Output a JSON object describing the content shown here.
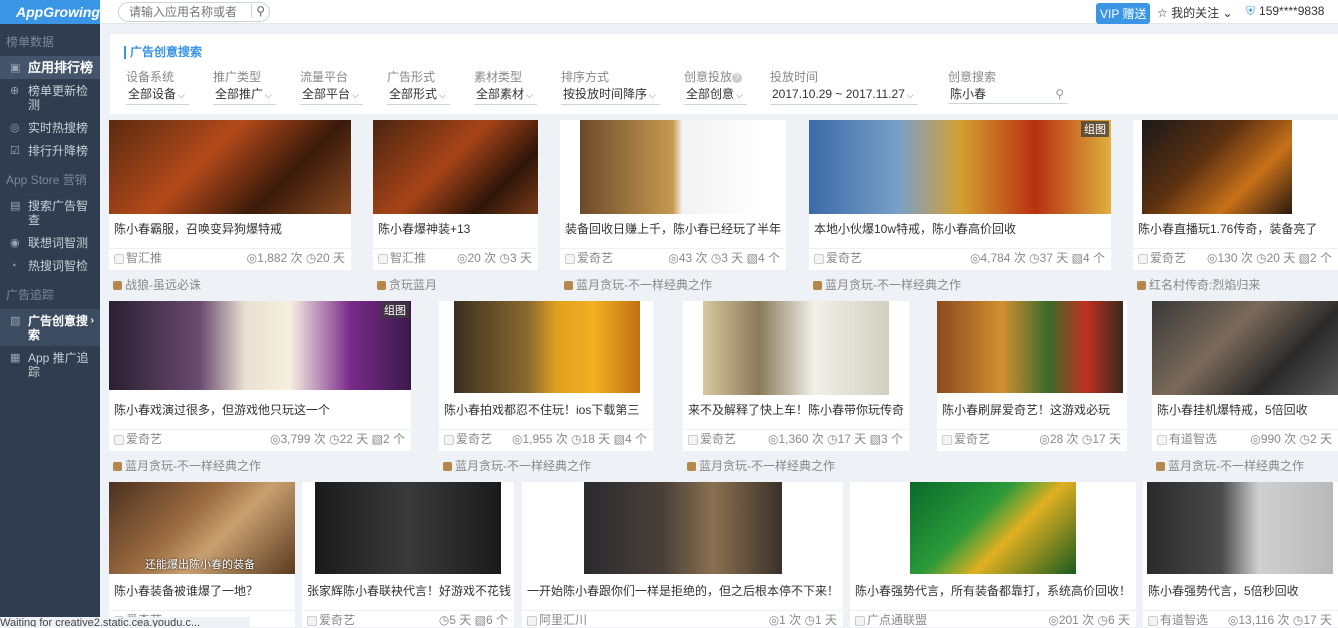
{
  "sidebar": {
    "logo": "AppGrowing",
    "sections": [
      {
        "title": "榜单数据",
        "items": [
          {
            "label": "应用排行榜",
            "icon": "▣"
          },
          {
            "label": "榜单更新检测",
            "icon": "⊕"
          },
          {
            "label": "实时热搜榜",
            "icon": "◎"
          },
          {
            "label": "排行升降榜",
            "icon": "☑"
          }
        ]
      },
      {
        "title": "App Store 营销",
        "items": [
          {
            "label": "搜索广告智查",
            "icon": "▤"
          },
          {
            "label": "联想词智测",
            "icon": "◉"
          },
          {
            "label": "热搜词智检",
            "icon": "◔"
          }
        ]
      },
      {
        "title": "广告追踪",
        "items": [
          {
            "label": "广告创意搜索",
            "icon": "▧",
            "chevron": "›"
          },
          {
            "label": "App 推广追踪",
            "icon": "▦"
          }
        ]
      }
    ]
  },
  "topbar": {
    "search_placeholder": "请输入应用名称或者",
    "vip_label": "VIP 赠送",
    "follow_label": "我的关注",
    "follow_arrow": "⌄",
    "user": "159****9838"
  },
  "filters": {
    "title": "广告创意搜索",
    "items": [
      {
        "label": "设备系统",
        "value": "全部设备"
      },
      {
        "label": "推广类型",
        "value": "全部推广"
      },
      {
        "label": "流量平台",
        "value": "全部平台"
      },
      {
        "label": "广告形式",
        "value": "全部形式"
      },
      {
        "label": "素材类型",
        "value": "全部素材"
      },
      {
        "label": "排序方式",
        "value": "按投放时间降序"
      },
      {
        "label": "创意投放",
        "value": "全部创意"
      },
      {
        "label": "投放时间",
        "value": "2017.10.29 ~ 2017.11.27"
      },
      {
        "label": "创意搜索",
        "value": "陈小春"
      }
    ]
  },
  "cards": [
    {
      "caption": "陈小春霸服，召唤变异狗爆特戒",
      "media": "智汇推",
      "stats": "◎1,882 次 ◷20 天",
      "app": "战狼-虽远必诛",
      "tag": ""
    },
    {
      "caption": "陈小春爆神装+13",
      "media": "智汇推",
      "stats": "◎20 次 ◷3 天",
      "app": "贪玩蓝月",
      "tag": ""
    },
    {
      "caption": "装备回收日赚上千，陈小春已经玩了半年",
      "media": "爱奇艺",
      "stats": "◎43 次 ◷3 天 ▧4 个",
      "app": "蓝月贪玩-不一样经典之作",
      "tag": ""
    },
    {
      "caption": "本地小伙爆10w特戒，陈小春高价回收",
      "media": "爱奇艺",
      "stats": "◎4,784 次 ◷37 天 ▧4 个",
      "app": "蓝月贪玩-不一样经典之作",
      "tag": "组图"
    },
    {
      "caption": "陈小春直播玩1.76传奇，装备亮了",
      "media": "爱奇艺",
      "stats": "◎130 次 ◷20 天 ▧2 个",
      "app": "红名村传奇:烈焰归来",
      "tag": ""
    },
    {
      "caption": "陈小春戏演过很多，但游戏他只玩这一个",
      "media": "爱奇艺",
      "stats": "◎3,799 次 ◷22 天 ▧2 个",
      "app": "蓝月贪玩-不一样经典之作",
      "tag": "组图"
    },
    {
      "caption": "陈小春拍戏都忍不住玩！ios下载第三",
      "media": "爱奇艺",
      "stats": "◎1,955 次 ◷18 天 ▧4 个",
      "app": "蓝月贪玩-不一样经典之作",
      "tag": ""
    },
    {
      "caption": "来不及解释了快上车！陈小春带你玩传奇",
      "media": "爱奇艺",
      "stats": "◎1,360 次 ◷17 天 ▧3 个",
      "app": "蓝月贪玩-不一样经典之作",
      "tag": ""
    },
    {
      "caption": "陈小春刷屏爱奇艺！这游戏必玩",
      "media": "爱奇艺",
      "stats": "◎28 次 ◷17 天",
      "app": "",
      "tag": ""
    },
    {
      "caption": "陈小春挂机爆特戒，5倍回收",
      "media": "有道智选",
      "stats": "◎990 次 ◷2 天",
      "app": "蓝月贪玩-不一样经典之作",
      "tag": ""
    },
    {
      "caption": "陈小春装备被谁爆了一地？",
      "media": "爱奇艺",
      "stats": "",
      "app": "",
      "tag": "",
      "overlay": "还能爆出陈小春的装备"
    },
    {
      "caption": "张家辉陈小春联袂代言！好游戏不花钱",
      "media": "爱奇艺",
      "stats": "◷5 天 ▧6 个",
      "app": "",
      "tag": ""
    },
    {
      "caption": "一开始陈小春跟你们一样是拒绝的，但之后根本停不下来！",
      "media": "阿里汇川",
      "stats": "◎1 次 ◷1 天",
      "app": "",
      "tag": ""
    },
    {
      "caption": "陈小春强势代言，所有装备都靠打，系统高价回收！",
      "media": "广点通联盟",
      "stats": "◎201 次 ◷6 天",
      "app": "",
      "tag": ""
    },
    {
      "caption": "陈小春强势代言，5倍秒回收",
      "media": "有道智选",
      "stats": "◎13,116 次 ◷17 天",
      "app": "",
      "tag": ""
    }
  ],
  "status_text": "Waiting for creative2.static.cea.youdu.c..."
}
